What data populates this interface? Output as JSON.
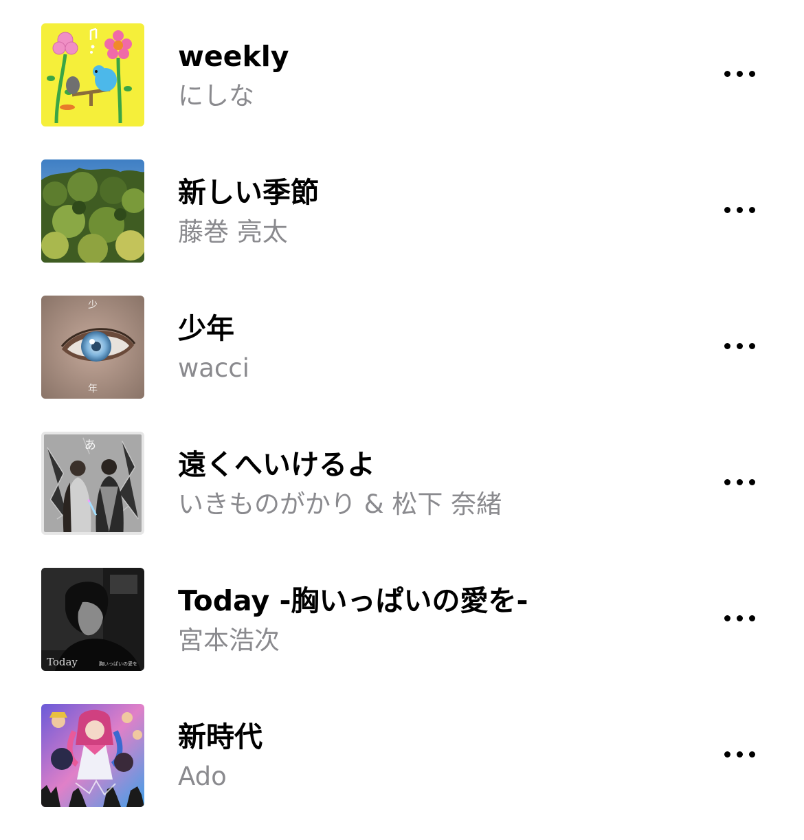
{
  "songs": [
    {
      "title": "weekly",
      "artist": "にしな",
      "artwork": "yellow-flowers-artwork",
      "color": "#f5ef3a"
    },
    {
      "title": "新しい季節",
      "artist": "藤巻 亮太",
      "artwork": "forest-photo-artwork",
      "color": "#4d6b2c"
    },
    {
      "title": "少年",
      "artist": "wacci",
      "artwork": "eye-closeup-artwork",
      "color": "#b9a196"
    },
    {
      "title": "遠くへいけるよ",
      "artist": "いきものがかり & 松下 奈緒",
      "artwork": "duo-portrait-artwork",
      "color": "#9a9a9a"
    },
    {
      "title": "Today -胸いっぱいの愛を-",
      "artist": "宮本浩次",
      "artwork": "monochrome-portrait-artwork",
      "color": "#1e1e1e"
    },
    {
      "title": "新時代",
      "artist": "Ado",
      "artwork": "anime-characters-artwork",
      "color": "#c85a9a"
    }
  ],
  "artwork_text": {
    "shonen_top": "少",
    "shonen_bottom": "年",
    "today_label": "Today",
    "today_subtitle": "胸いっぱいの愛を"
  },
  "more_icon": "ellipsis-icon"
}
